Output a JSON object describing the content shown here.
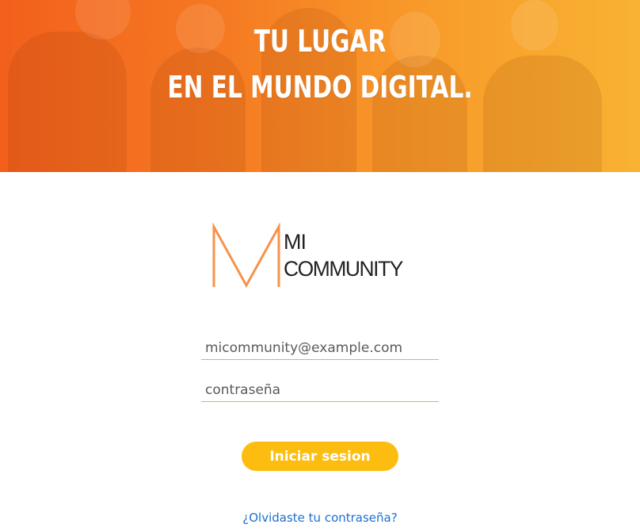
{
  "hero": {
    "title_line1": "TU LUGAR",
    "title_line2": "EN EL MUNDO DIGITAL.",
    "gradient_start": "#f2601c",
    "gradient_end": "#f9b232"
  },
  "logo": {
    "letter": "M",
    "line1": "MI",
    "line2": "COMMUNITY",
    "accent_color": "#f7924a"
  },
  "form": {
    "email_placeholder": "micommunity@example.com",
    "password_placeholder": "contraseña",
    "submit_label": "Iniciar sesion",
    "forgot_link": "¿Olvidaste tu contraseña?",
    "button_color": "#fdbd10",
    "link_color": "#1a6fd0"
  }
}
